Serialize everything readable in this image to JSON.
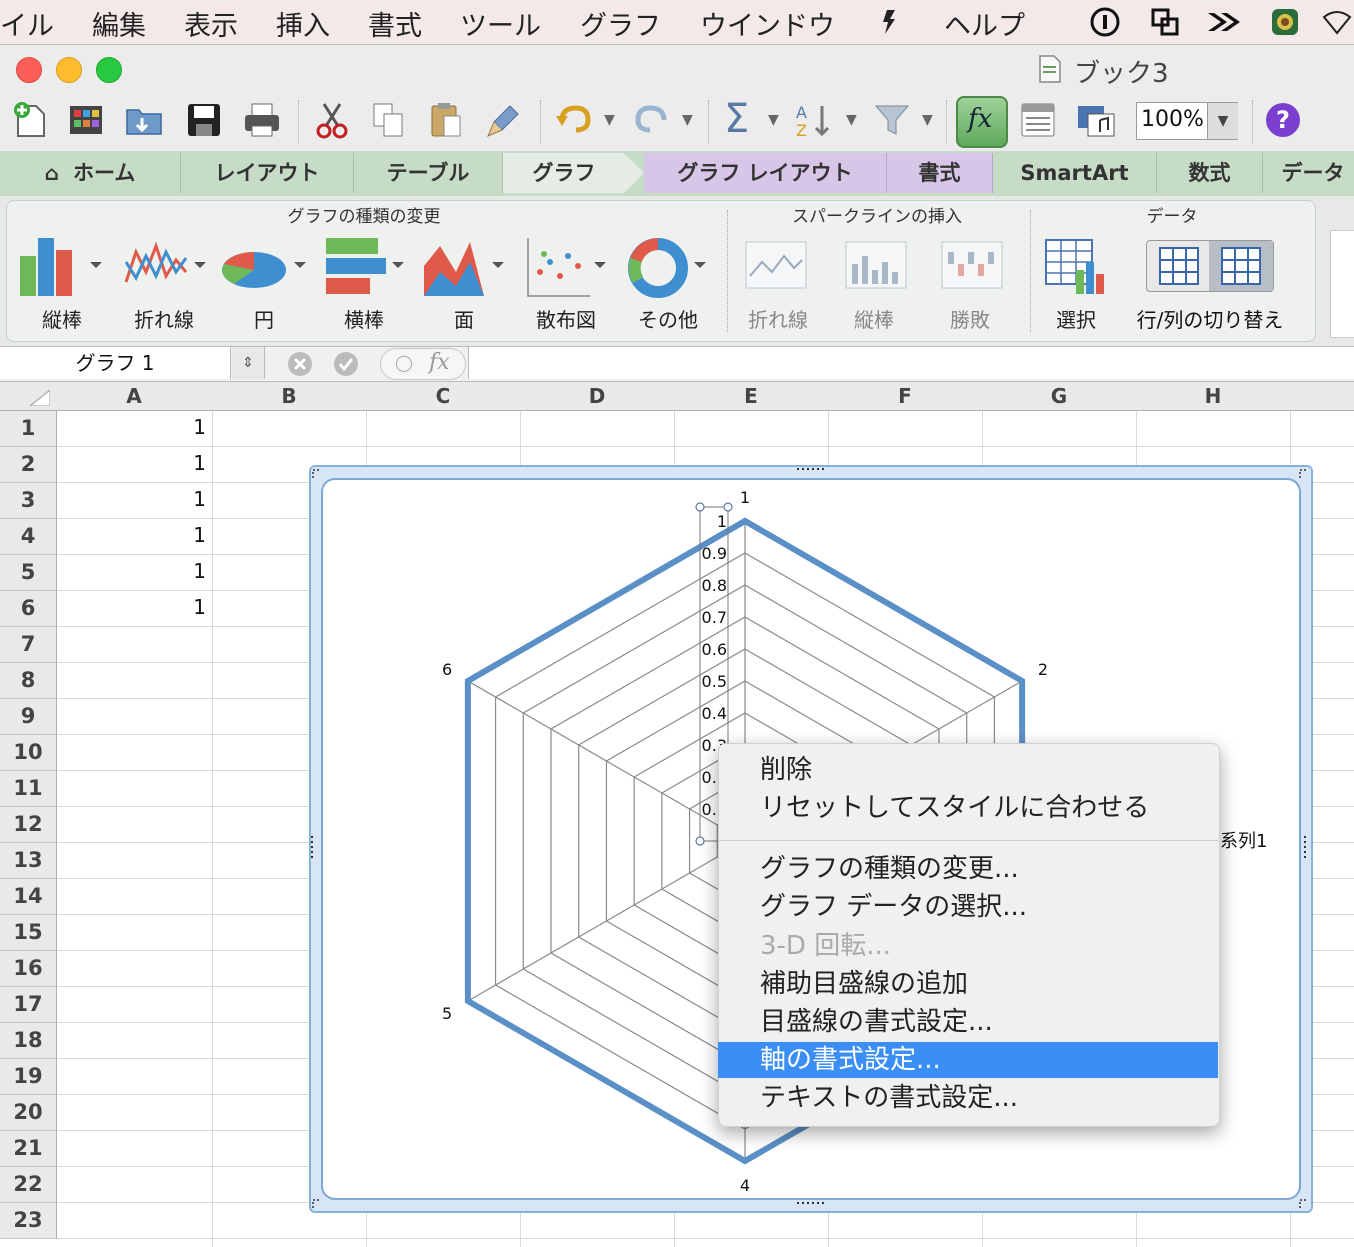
{
  "menubar": {
    "items": [
      "イル",
      "編集",
      "表示",
      "挿入",
      "書式",
      "ツール",
      "グラフ",
      "ウインドウ",
      "ヘルプ"
    ]
  },
  "window": {
    "title": "ブック3"
  },
  "toolbar": {
    "zoom": "100%"
  },
  "ribbon": {
    "tabs": [
      "ホーム",
      "レイアウト",
      "テーブル",
      "グラフ",
      "グラフ レイアウト",
      "書式",
      "SmartArt",
      "数式",
      "データ"
    ],
    "active_tab": "グラフ",
    "groups": {
      "chart_type": {
        "title": "グラフの種類の変更",
        "buttons": [
          "縦棒",
          "折れ線",
          "円",
          "横棒",
          "面",
          "散布図",
          "その他"
        ]
      },
      "sparkline": {
        "title": "スパークラインの挿入",
        "buttons": [
          "折れ線",
          "縦棒",
          "勝敗"
        ]
      },
      "data": {
        "title": "データ",
        "buttons": [
          "選択",
          "行/列の切り替え"
        ]
      }
    }
  },
  "formula_bar": {
    "name_box": "グラフ 1"
  },
  "grid": {
    "columns": [
      "A",
      "B",
      "C",
      "D",
      "E",
      "F",
      "G",
      "H"
    ],
    "rows": [
      "1",
      "2",
      "3",
      "4",
      "5",
      "6",
      "7",
      "8",
      "9",
      "10",
      "11",
      "12",
      "13",
      "14",
      "15",
      "16",
      "17",
      "18",
      "19",
      "20",
      "21",
      "22",
      "23"
    ],
    "col_a_values": [
      "1",
      "1",
      "1",
      "1",
      "1",
      "1"
    ]
  },
  "chart_data": {
    "type": "radar",
    "categories": [
      "1",
      "2",
      "3",
      "4",
      "5",
      "6"
    ],
    "series": [
      {
        "name": "系列1",
        "values": [
          1,
          1,
          1,
          1,
          1,
          1
        ]
      }
    ],
    "axis_ticks": [
      "0.1",
      "0.2",
      "0.3",
      "0.4",
      "0.5",
      "0.6",
      "0.7",
      "0.8",
      "0.9",
      "1"
    ],
    "visible_axis_ticks": [
      "1",
      "0.9",
      "0.8",
      "0.7",
      "0.6",
      "0.5",
      "0.4",
      "0.3",
      "0.2",
      "0.1"
    ],
    "ylim": [
      0,
      1
    ],
    "legend_position": "right",
    "line_color": "#5b8fc7"
  },
  "context_menu": {
    "items": [
      {
        "label": "削除",
        "disabled": false
      },
      {
        "label": "リセットしてスタイルに合わせる",
        "disabled": false
      },
      {
        "label": "グラフの種類の変更...",
        "disabled": false
      },
      {
        "label": "グラフ データの選択...",
        "disabled": false
      },
      {
        "label": "3-D 回転...",
        "disabled": true
      },
      {
        "label": "補助目盛線の追加",
        "disabled": false
      },
      {
        "label": "目盛線の書式設定...",
        "disabled": false
      },
      {
        "label": "軸の書式設定...",
        "disabled": false,
        "selected": true
      },
      {
        "label": "テキストの書式設定...",
        "disabled": false
      }
    ]
  }
}
